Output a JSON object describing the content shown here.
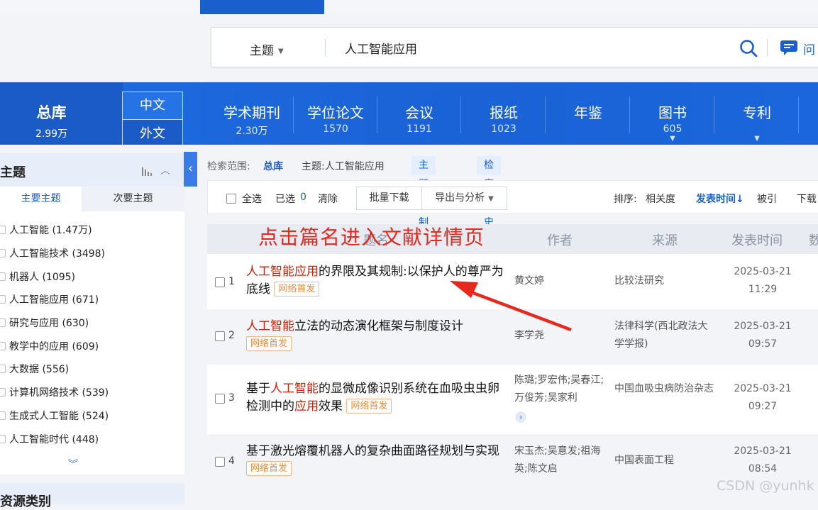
{
  "search": {
    "field_label": "主题",
    "query": "人工智能应用",
    "ask_label": "问"
  },
  "nav": {
    "total": {
      "label": "总库",
      "count": "2.99万"
    },
    "lang_cn": "中文",
    "lang_en": "外文",
    "tabs": [
      {
        "label": "学术期刊",
        "count": "2.30万"
      },
      {
        "label": "学位论文",
        "count": "1570"
      },
      {
        "label": "会议",
        "count": "1191"
      },
      {
        "label": "报纸",
        "count": "1023"
      },
      {
        "label": "年鉴",
        "count": ""
      },
      {
        "label": "图书",
        "count": "605"
      },
      {
        "label": "专利",
        "count": ""
      }
    ]
  },
  "sidebar": {
    "title": "主题",
    "tabs": [
      "主要主题",
      "次要主题"
    ],
    "items": [
      {
        "label": "人工智能 (1.47万)"
      },
      {
        "label": "人工智能技术 (3498)"
      },
      {
        "label": "机器人 (1095)"
      },
      {
        "label": "人工智能应用 (671)"
      },
      {
        "label": "研究与应用 (630)"
      },
      {
        "label": "教学中的应用 (609)"
      },
      {
        "label": "大数据 (556)"
      },
      {
        "label": "计算机网络技术 (539)"
      },
      {
        "label": "生成式人工智能 (524)"
      },
      {
        "label": "人工智能时代 (448)"
      }
    ],
    "second_title": "资源类别"
  },
  "scope": {
    "label": "检索范围:",
    "value": "总库",
    "topic": "主题:人工智能应用",
    "customize": "主题定制",
    "history": "检索历史"
  },
  "toolbar": {
    "select_all": "全选",
    "selected_label": "已选",
    "selected_count": "0",
    "clear": "清除",
    "batch_download": "批量下载",
    "export": "导出与分析",
    "sort_label": "排序:",
    "sort_relevance": "相关度",
    "sort_date": "发表时间",
    "sort_cited": "被引",
    "sort_downloads": "下载"
  },
  "table": {
    "headers": {
      "title": "题名",
      "author": "作者",
      "source": "来源",
      "date": "发表时间",
      "extra": "数"
    },
    "rows": [
      {
        "num": "1",
        "title_parts": [
          {
            "text": "人工智能应用",
            "hl": true
          },
          {
            "text": "的界限及其规制:以保护人的尊严为底线",
            "hl": false
          }
        ],
        "badge": "网络首发",
        "authors": "黄文婷",
        "source": "比较法研究",
        "date": "2025-03-21",
        "time": "11:29"
      },
      {
        "num": "2",
        "title_parts": [
          {
            "text": "人工智能",
            "hl": true
          },
          {
            "text": "立法的动态演化框架与制度设计",
            "hl": false
          }
        ],
        "badge": "网络首发",
        "authors": "李学尧",
        "source": "法律科学(西北政法大学学报)",
        "date": "2025-03-21",
        "time": "09:57"
      },
      {
        "num": "3",
        "title_parts": [
          {
            "text": "基于",
            "hl": false
          },
          {
            "text": "人工智能",
            "hl": true
          },
          {
            "text": "的显微成像识别系统在血吸虫虫卵检测中的",
            "hl": false
          },
          {
            "text": "应用",
            "hl": true
          },
          {
            "text": "效果",
            "hl": false
          }
        ],
        "badge": "网络首发",
        "authors": "陈璐;罗宏伟;吴春江;万俊芳;吴家利",
        "source": "中国血吸虫病防治杂志",
        "date": "2025-03-21",
        "time": "09:27"
      },
      {
        "num": "4",
        "title_parts": [
          {
            "text": "基于激光熔覆机器人的复杂曲面路径规划与实现",
            "hl": false
          }
        ],
        "badge": "网络首发",
        "authors": "宋玉杰;吴意发;祖海英;陈文启",
        "source": "中国表面工程",
        "date": "2025-03-21",
        "time": "08:54"
      }
    ]
  },
  "annotation": "点击篇名进入文献详情页",
  "watermark": "CSDN @yunhk",
  "colors": {
    "brand_blue": "#1a62d6",
    "highlight_red": "#d81e06",
    "badge_orange": "#f08c3a",
    "annotation_red": "#e8281c"
  }
}
